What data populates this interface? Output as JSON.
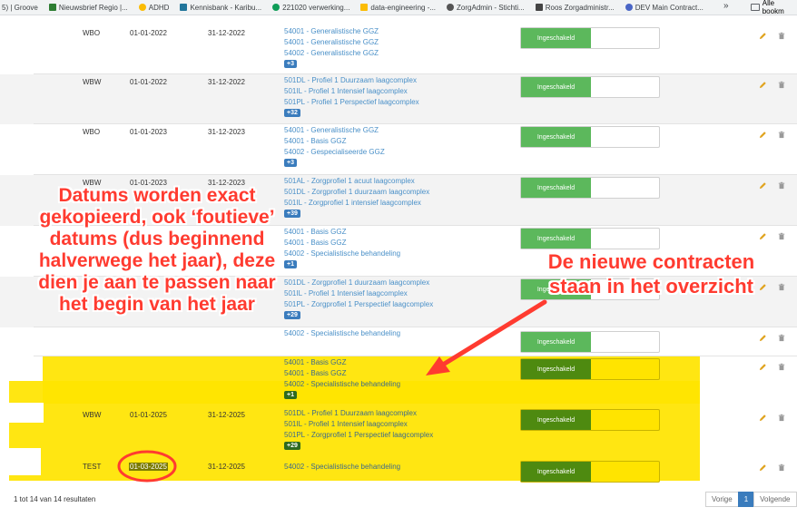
{
  "bookmarks": [
    {
      "label": "5) | Groove",
      "color": ""
    },
    {
      "label": "Nieuwsbrief Regio |...",
      "color": "#2e7d32"
    },
    {
      "label": "ADHD",
      "color": "#fbbc04"
    },
    {
      "label": "Kennisbank - Karibu...",
      "color": "#21759b"
    },
    {
      "label": "221020 verwerking...",
      "color": "#0f9d58"
    },
    {
      "label": "data-engineering -...",
      "color": "#fbbc04"
    },
    {
      "label": "ZorgAdmin - Stichti...",
      "color": "#555555"
    },
    {
      "label": "Roos Zorgadministr...",
      "color": "#444444"
    },
    {
      "label": "DEV Main Contract...",
      "color": "#4a66c6"
    }
  ],
  "bookmarks_more": "»",
  "bookmarks_all": "Alle bookm",
  "toggle_label": "Ingeschakeld",
  "rows": [
    {
      "code": "WBO",
      "start": "01-01-2022",
      "end": "31-12-2022",
      "products": [
        "54001 - Generalistische GGZ",
        "54001 - Generalistische GGZ",
        "54002 - Generalistische GGZ"
      ],
      "more": "+3"
    },
    {
      "code": "WBW",
      "start": "01-01-2022",
      "end": "31-12-2022",
      "products": [
        "501DL - Profiel 1 Duurzaam laagcomplex",
        "501IL - Profiel 1 Intensief laagcomplex",
        "501PL - Profiel 1 Perspectief laagcomplex"
      ],
      "more": "+32"
    },
    {
      "code": "WBO",
      "start": "01-01-2023",
      "end": "31-12-2023",
      "products": [
        "54001 - Generalistische GGZ",
        "54001 - Basis GGZ",
        "54002 - Gespecialiseerde GGZ"
      ],
      "more": "+3"
    },
    {
      "code": "WBW",
      "start": "01-01-2023",
      "end": "31-12-2023",
      "products": [
        "501AL - Zorgprofiel 1 acuut laagcomplex",
        "501DL - Zorgprofiel 1 duurzaam laagcomplex",
        "501IL - Zorgprofiel 1 intensief laagcomplex"
      ],
      "more": "+39"
    },
    {
      "code": "",
      "start": "",
      "end": "",
      "products": [
        "54001 - Basis GGZ",
        "54001 - Basis GGZ",
        "54002 - Specialistische behandeling"
      ],
      "more": "+1"
    },
    {
      "code": "",
      "start": "",
      "end": "",
      "products": [
        "501DL - Zorgprofiel 1 duurzaam laagcomplex",
        "501IL - Profiel 1 Intensief laagcomplex",
        "501PL - Zorgprofiel 1 Perspectief laagcomplex"
      ],
      "more": "+29"
    },
    {
      "code": "",
      "start": "",
      "end": "",
      "products": [
        "54002 - Specialistische behandeling"
      ],
      "more": ""
    },
    {
      "code": "",
      "start": "",
      "end": "",
      "products": [
        "54001 - Basis GGZ",
        "54001 - Basis GGZ",
        "54002 - Specialistische behandeling"
      ],
      "more": "+1"
    },
    {
      "code": "WBW",
      "start": "01-01-2025",
      "end": "31-12-2025",
      "products": [
        "501DL - Profiel 1 Duurzaam laagcomplex",
        "501IL - Profiel 1 Intensief laagcomplex",
        "501PL - Zorgprofiel 1 Perspectief laagcomplex"
      ],
      "more": "+29"
    },
    {
      "code": "TEST",
      "start": "01-03-2025",
      "end": "31-12-2025",
      "products": [
        "54002 - Specialistische behandeling"
      ],
      "more": ""
    }
  ],
  "footer": {
    "info": "1 tot 14 van 14 resultaten",
    "prev": "Vorige",
    "page": "1",
    "next": "Volgende"
  },
  "annotations": {
    "left": "Datums worden exact gekopieerd, ook ‘foutieve’ datums (dus beginnend halverwege het jaar), deze dien je aan te passen naar het begin van het jaar",
    "right": "De nieuwe contracten staan in het overzicht"
  },
  "colors": {
    "toggle_on": "#5cb85c",
    "link": "#4a90c8",
    "badge": "#3a7cbd",
    "highlight": "#ffe400",
    "annotation": "#ff3b30"
  }
}
